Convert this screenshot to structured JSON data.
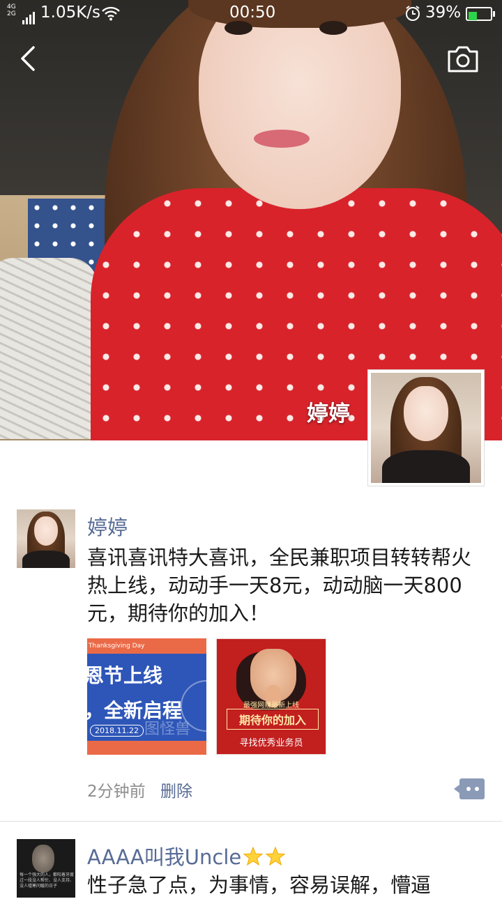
{
  "status_bar": {
    "network_type_top": "4G",
    "network_type_bottom": "2G",
    "speed": "1.05K/s",
    "time": "00:50",
    "battery_percent": "39%",
    "battery_level": 0.39,
    "battery_color": "#2fd14a"
  },
  "header": {
    "back_icon": "chevron-left-icon",
    "camera_icon": "camera-icon"
  },
  "profile": {
    "name": "婷婷"
  },
  "posts": [
    {
      "author": "婷婷",
      "text": "喜讯喜讯特大喜讯，全民兼职项目转转帮火热上线，动动手一天8元，动动脑一天800元，期待你的加入！",
      "images": [
        {
          "line1": "Thanksgiving Day",
          "line2": "恩节上线",
          "line3": "，全新启程",
          "date": "2018.11.22",
          "watermark": "图怪兽"
        },
        {
          "line1": "最强网赚最新上线",
          "line2": "期待你的加入",
          "line3": "寻找优秀业务员"
        }
      ],
      "time": "2分钟前",
      "delete_label": "删除"
    },
    {
      "author": "AAAA叫我Uncle",
      "author_emoji": "star-icon",
      "text": "性子急了点，为事情，容易误解，懵逼",
      "avatar_text": "每一个强大的人，都咬着牙度过一段没人帮忙、没人支持、没人嘘寒问暖的日子"
    }
  ],
  "colors": {
    "link": "#576b95",
    "text": "#1a1a1a",
    "meta": "#8e8e8e",
    "comment_button": "#8a9ab7"
  }
}
